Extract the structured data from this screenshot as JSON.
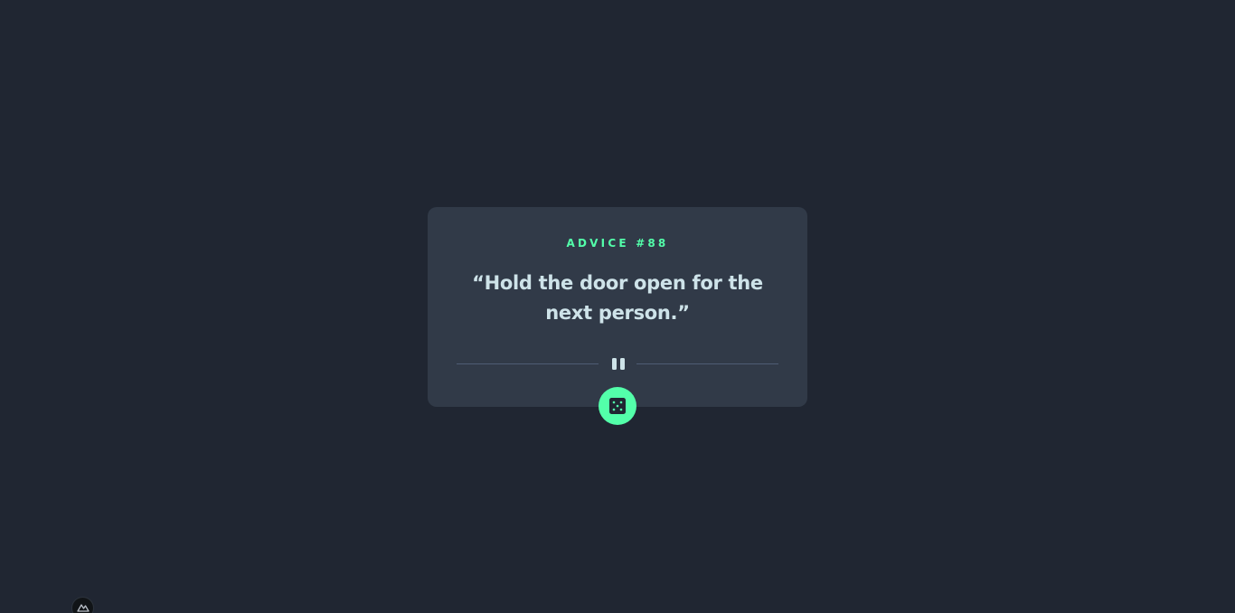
{
  "advice": {
    "id_label": "ADVICE #88",
    "quote": "“Hold the door open for the next person.”"
  },
  "divider": {
    "icon": "pause-icon"
  },
  "dice_button": {
    "icon": "dice-icon"
  },
  "devtools": {
    "icon": "nuxt-logo-icon"
  },
  "colors": {
    "background": "#202632",
    "card": "#313a48",
    "accent": "#53ffaa",
    "text": "#cee3e9",
    "divider": "#4f5d74"
  }
}
